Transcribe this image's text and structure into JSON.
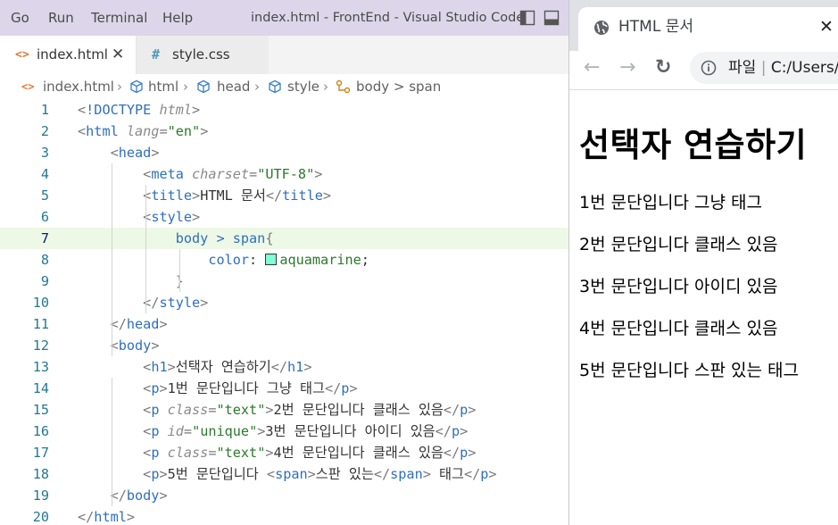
{
  "vscode": {
    "menu": [
      "Go",
      "Run",
      "Terminal",
      "Help"
    ],
    "window_title": "index.html - FrontEnd - Visual Studio Code",
    "tabs": [
      {
        "icon": "<>",
        "label": "index.html",
        "close": "✕"
      },
      {
        "icon": "#",
        "label": "style.css"
      }
    ],
    "breadcrumb": [
      "index.html",
      "html",
      "head",
      "style",
      "body > span"
    ],
    "current_line": 7,
    "lines": [
      [
        [
          "tok-punct",
          "<"
        ],
        [
          "tok-doctype",
          "!DOCTYPE "
        ],
        [
          "tok-attr",
          "html"
        ],
        [
          "tok-punct",
          ">"
        ]
      ],
      [
        [
          "tok-punct",
          "<"
        ],
        [
          "tok-tag",
          "html "
        ],
        [
          "tok-attr",
          "lang"
        ],
        [
          "tok-punct",
          "="
        ],
        [
          "tok-str",
          "\"en\""
        ],
        [
          "tok-punct",
          ">"
        ]
      ],
      [
        [
          "tok-text",
          "    "
        ],
        [
          "tok-punct",
          "<"
        ],
        [
          "tok-tag",
          "head"
        ],
        [
          "tok-punct",
          ">"
        ]
      ],
      [
        [
          "tok-text",
          "        "
        ],
        [
          "tok-punct",
          "<"
        ],
        [
          "tok-tag",
          "meta "
        ],
        [
          "tok-attr",
          "charset"
        ],
        [
          "tok-punct",
          "="
        ],
        [
          "tok-str",
          "\"UTF-8\""
        ],
        [
          "tok-punct",
          ">"
        ]
      ],
      [
        [
          "tok-text",
          "        "
        ],
        [
          "tok-punct",
          "<"
        ],
        [
          "tok-tag",
          "title"
        ],
        [
          "tok-punct",
          ">"
        ],
        [
          "tok-text",
          "HTML 문서"
        ],
        [
          "tok-punct",
          "</"
        ],
        [
          "tok-tag",
          "title"
        ],
        [
          "tok-punct",
          ">"
        ]
      ],
      [
        [
          "tok-text",
          "        "
        ],
        [
          "tok-punct",
          "<"
        ],
        [
          "tok-tag",
          "style"
        ],
        [
          "tok-punct",
          ">"
        ]
      ],
      [
        [
          "tok-text",
          "            "
        ],
        [
          "tok-sel",
          "body > span"
        ],
        [
          "tok-punct",
          "{"
        ]
      ],
      [
        [
          "tok-text",
          "                "
        ],
        [
          "tok-prop",
          "color"
        ],
        [
          "tok-text",
          ": "
        ],
        [
          "swatch",
          ""
        ],
        [
          "tok-val",
          "aquamarine"
        ],
        [
          "tok-text",
          ";"
        ]
      ],
      [
        [
          "tok-text",
          "            "
        ],
        [
          "tok-punct",
          "}"
        ]
      ],
      [
        [
          "tok-text",
          "        "
        ],
        [
          "tok-punct",
          "</"
        ],
        [
          "tok-tag",
          "style"
        ],
        [
          "tok-punct",
          ">"
        ]
      ],
      [
        [
          "tok-text",
          "    "
        ],
        [
          "tok-punct",
          "</"
        ],
        [
          "tok-tag",
          "head"
        ],
        [
          "tok-punct",
          ">"
        ]
      ],
      [
        [
          "tok-text",
          "    "
        ],
        [
          "tok-punct",
          "<"
        ],
        [
          "tok-tag",
          "body"
        ],
        [
          "tok-punct",
          ">"
        ]
      ],
      [
        [
          "tok-text",
          "        "
        ],
        [
          "tok-punct",
          "<"
        ],
        [
          "tok-tag",
          "h1"
        ],
        [
          "tok-punct",
          ">"
        ],
        [
          "tok-text",
          "선택자 연습하기"
        ],
        [
          "tok-punct",
          "</"
        ],
        [
          "tok-tag",
          "h1"
        ],
        [
          "tok-punct",
          ">"
        ]
      ],
      [
        [
          "tok-text",
          "        "
        ],
        [
          "tok-punct",
          "<"
        ],
        [
          "tok-tag",
          "p"
        ],
        [
          "tok-punct",
          ">"
        ],
        [
          "tok-text",
          "1번 문단입니다 그냥 태그"
        ],
        [
          "tok-punct",
          "</"
        ],
        [
          "tok-tag",
          "p"
        ],
        [
          "tok-punct",
          ">"
        ]
      ],
      [
        [
          "tok-text",
          "        "
        ],
        [
          "tok-punct",
          "<"
        ],
        [
          "tok-tag",
          "p "
        ],
        [
          "tok-attr",
          "class"
        ],
        [
          "tok-punct",
          "="
        ],
        [
          "tok-str",
          "\"text\""
        ],
        [
          "tok-punct",
          ">"
        ],
        [
          "tok-text",
          "2번 문단입니다 클래스 있음"
        ],
        [
          "tok-punct",
          "</"
        ],
        [
          "tok-tag",
          "p"
        ],
        [
          "tok-punct",
          ">"
        ]
      ],
      [
        [
          "tok-text",
          "        "
        ],
        [
          "tok-punct",
          "<"
        ],
        [
          "tok-tag",
          "p "
        ],
        [
          "tok-attr",
          "id"
        ],
        [
          "tok-punct",
          "="
        ],
        [
          "tok-str",
          "\"unique\""
        ],
        [
          "tok-punct",
          ">"
        ],
        [
          "tok-text",
          "3번 문단입니다 아이디 있음"
        ],
        [
          "tok-punct",
          "</"
        ],
        [
          "tok-tag",
          "p"
        ],
        [
          "tok-punct",
          ">"
        ]
      ],
      [
        [
          "tok-text",
          "        "
        ],
        [
          "tok-punct",
          "<"
        ],
        [
          "tok-tag",
          "p "
        ],
        [
          "tok-attr",
          "class"
        ],
        [
          "tok-punct",
          "="
        ],
        [
          "tok-str",
          "\"text\""
        ],
        [
          "tok-punct",
          ">"
        ],
        [
          "tok-text",
          "4번 문단입니다 클래스 있음"
        ],
        [
          "tok-punct",
          "</"
        ],
        [
          "tok-tag",
          "p"
        ],
        [
          "tok-punct",
          ">"
        ]
      ],
      [
        [
          "tok-text",
          "        "
        ],
        [
          "tok-punct",
          "<"
        ],
        [
          "tok-tag",
          "p"
        ],
        [
          "tok-punct",
          ">"
        ],
        [
          "tok-text",
          "5번 문단입니다 "
        ],
        [
          "tok-punct",
          "<"
        ],
        [
          "tok-tag",
          "span"
        ],
        [
          "tok-punct",
          ">"
        ],
        [
          "tok-text",
          "스판 있는"
        ],
        [
          "tok-punct",
          "</"
        ],
        [
          "tok-tag",
          "span"
        ],
        [
          "tok-punct",
          ">"
        ],
        [
          "tok-text",
          " 태그"
        ],
        [
          "tok-punct",
          "</"
        ],
        [
          "tok-tag",
          "p"
        ],
        [
          "tok-punct",
          ">"
        ]
      ],
      [
        [
          "tok-text",
          "    "
        ],
        [
          "tok-punct",
          "</"
        ],
        [
          "tok-tag",
          "body"
        ],
        [
          "tok-punct",
          ">"
        ]
      ],
      [
        [
          "tok-punct",
          "</"
        ],
        [
          "tok-tag",
          "html"
        ],
        [
          "tok-punct",
          ">"
        ]
      ]
    ]
  },
  "browser": {
    "tab_title": "HTML 문서",
    "tab_close": "✕",
    "nav": {
      "back": "←",
      "forward": "→",
      "reload": "↻"
    },
    "address_label": "파일",
    "address_sep": "|",
    "address_path": "C:/Users/",
    "page": {
      "h1": "선택자 연습하기",
      "paragraphs": [
        "1번 문단입니다 그냥 태그",
        "2번 문단입니다 클래스 있음",
        "3번 문단입니다 아이디 있음",
        "4번 문단입니다 클래스 있음",
        "5번 문단입니다 스판 있는 태그"
      ]
    }
  },
  "colors": {
    "titlebar": "#ddd6ea",
    "current_line": "#eef8e6",
    "line_number": "#237893",
    "swatch_aquamarine": "#7fffd4",
    "html_icon": "#e37933",
    "css_icon": "#519aba"
  }
}
